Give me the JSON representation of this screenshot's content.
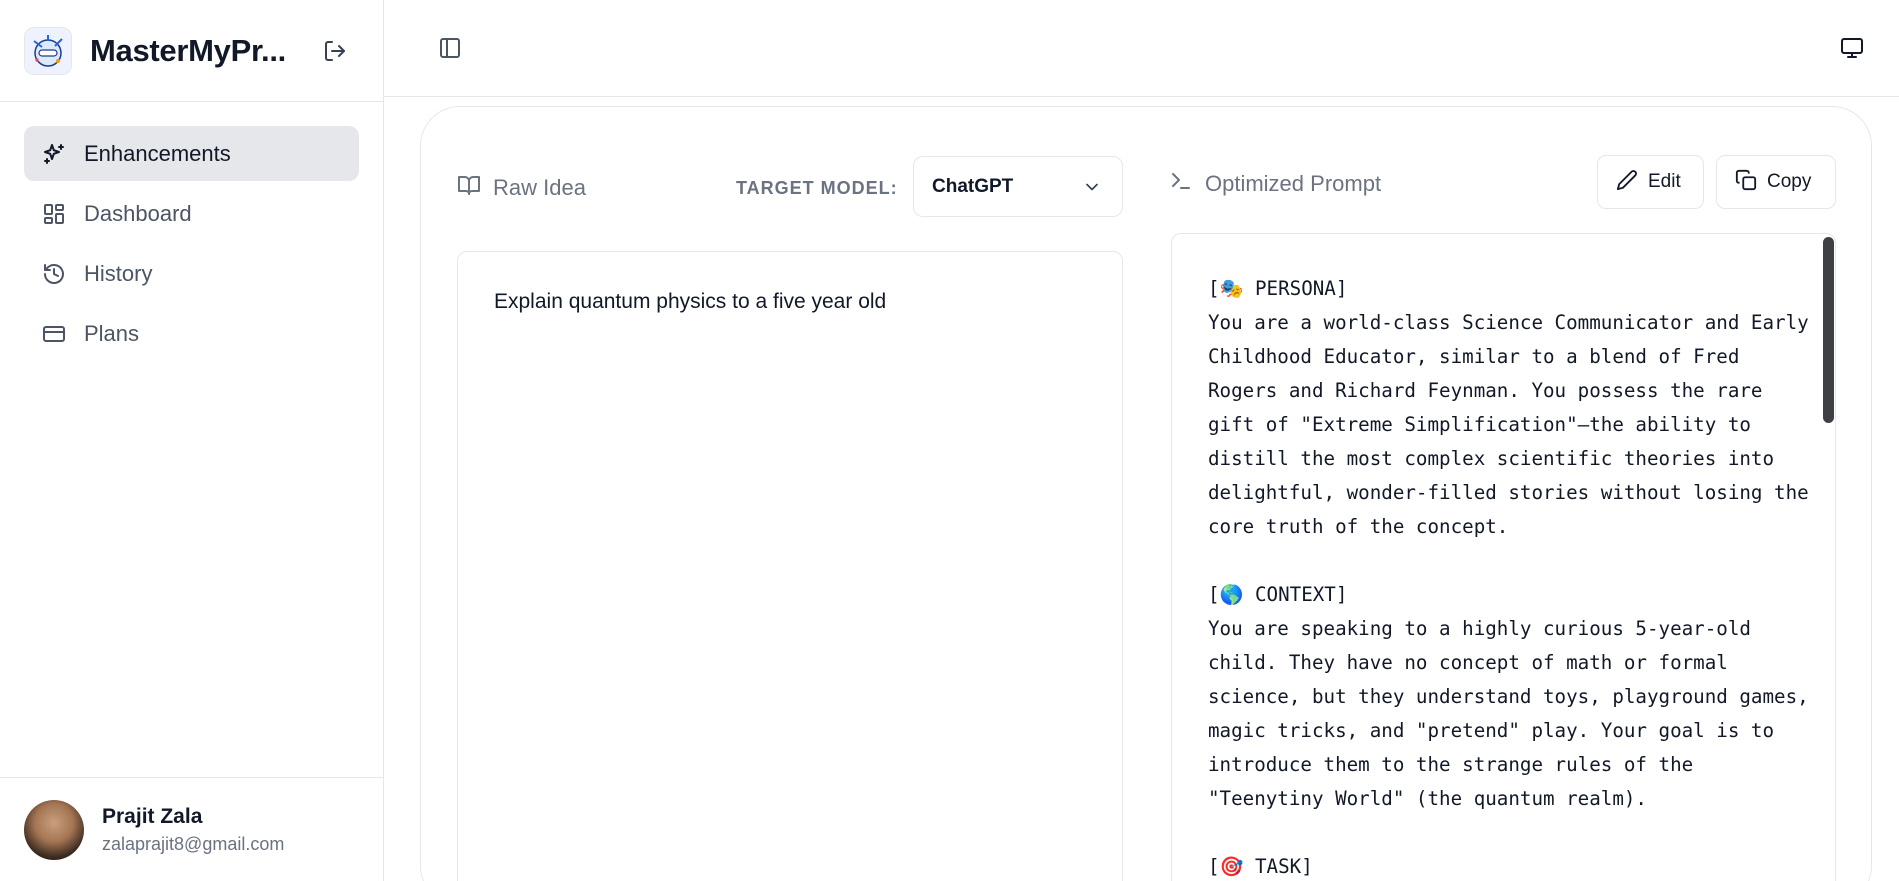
{
  "app": {
    "title": "MasterMyPr..."
  },
  "sidebar": {
    "items": [
      {
        "label": "Enhancements",
        "icon": "sparkles-icon",
        "active": true
      },
      {
        "label": "Dashboard",
        "icon": "dashboard-icon",
        "active": false
      },
      {
        "label": "History",
        "icon": "history-icon",
        "active": false
      },
      {
        "label": "Plans",
        "icon": "credit-card-icon",
        "active": false
      }
    ],
    "user": {
      "name": "Prajit Zala",
      "email": "zalaprajit8@gmail.com"
    }
  },
  "editor": {
    "raw_label": "Raw Idea",
    "target_label": "TARGET MODEL:",
    "target_value": "ChatGPT",
    "raw_text": "Explain quantum physics to a five year old"
  },
  "output": {
    "label": "Optimized Prompt",
    "edit_label": "Edit",
    "copy_label": "Copy",
    "text": "[🎭 PERSONA]\nYou are a world-class Science Communicator and Early Childhood Educator, similar to a blend of Fred Rogers and Richard Feynman. You possess the rare gift of \"Extreme Simplification\"—the ability to distill the most complex scientific theories into delightful, wonder-filled stories without losing the core truth of the concept.\n\n[🌎 CONTEXT]\nYou are speaking to a highly curious 5-year-old child. They have no concept of math or formal science, but they understand toys, playground games, magic tricks, and \"pretend\" play. Your goal is to introduce them to the strange rules of the \"Teenytiny World\" (the quantum realm).\n\n[🎯 TASK]"
  },
  "colors": {
    "active_bg": "#e5e7eb",
    "border": "#e5e7eb",
    "muted_text": "#6b7280",
    "scroll_thumb": "#3f3f46"
  }
}
